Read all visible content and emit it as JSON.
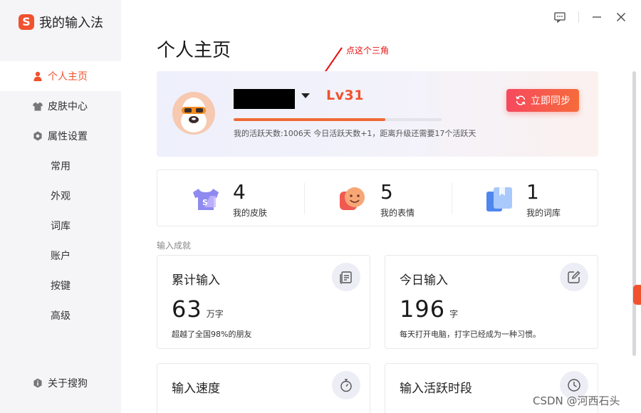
{
  "app": {
    "title": "我的输入法"
  },
  "sidebar": {
    "items": [
      {
        "label": "个人主页",
        "icon": "person-icon",
        "active": true
      },
      {
        "label": "皮肤中心",
        "icon": "tshirt-icon"
      },
      {
        "label": "属性设置",
        "icon": "settings-hex-icon"
      }
    ],
    "sub_items": [
      "常用",
      "外观",
      "词库",
      "账户",
      "按键",
      "高级"
    ],
    "about": "关于搜狗"
  },
  "page": {
    "title": "个人主页"
  },
  "annotation": {
    "text": "点这个三角",
    "color": "#e81010"
  },
  "profile": {
    "level": "Lv31",
    "progress_percent": 73,
    "active_days_text": "我的活跃天数:1006天 今日活跃天数+1，距离升级还需要17个活跃天",
    "sync_label": "立即同步"
  },
  "stats": [
    {
      "value": "4",
      "label": "我的皮肤",
      "icon": "skin-icon"
    },
    {
      "value": "5",
      "label": "我的表情",
      "icon": "emoji-icon"
    },
    {
      "value": "1",
      "label": "我的词库",
      "icon": "dictionary-icon"
    }
  ],
  "section": {
    "label": "输入成就"
  },
  "cards": [
    {
      "title": "累计输入",
      "value": "63",
      "unit": "万字",
      "desc": "超越了全国98%的朋友",
      "icon": "document-icon"
    },
    {
      "title": "今日输入",
      "value": "196",
      "unit": "字",
      "desc": "每天打开电脑，打字已经成为一种习惯。",
      "icon": "edit-icon"
    },
    {
      "title": "输入速度",
      "value": "",
      "unit": "",
      "desc": "",
      "icon": "stopwatch-icon"
    },
    {
      "title": "输入活跃时段",
      "value": "",
      "unit": "",
      "desc": "",
      "icon": "clock-icon"
    }
  ],
  "watermark": "CSDN @河西石头",
  "colors": {
    "accent": "#f0522e",
    "progress": "#f06a34",
    "sync_button": "#f6495e"
  }
}
